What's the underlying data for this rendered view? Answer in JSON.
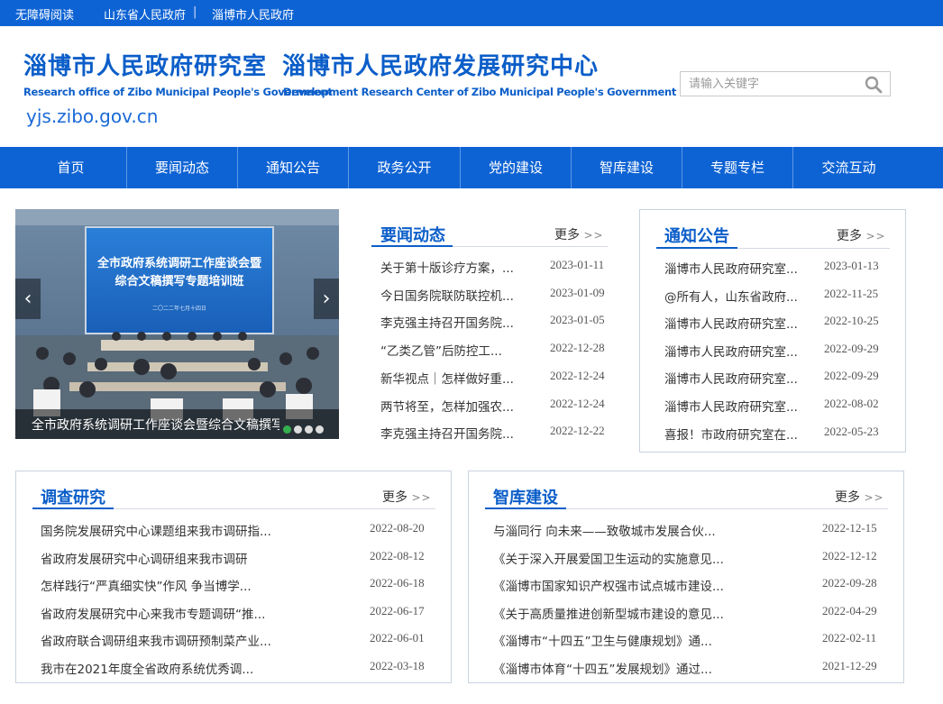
{
  "topbar": {
    "accessibility": "无障碍阅读",
    "link1": "山东省人民政府",
    "separator": "|",
    "link2": "淄博市人民政府"
  },
  "header": {
    "title_cn_1": "淄博市人民政府研究室",
    "title_cn_2": "淄博市人民政府发展研究中心",
    "title_en_1": "Research office of Zibo Municipal People's Government",
    "title_en_2": "Development Research Center of Zibo Municipal People's Government",
    "domain": "yjs.zibo.gov.cn",
    "search_placeholder": "请输入关键字"
  },
  "nav": [
    "首页",
    "要闻动态",
    "通知公告",
    "政务公开",
    "党的建设",
    "智库建设",
    "专题专栏",
    "交流互动"
  ],
  "slider": {
    "caption": "全市政府系统调研工作座谈会暨综合文稿撰写专题培训班",
    "screen_line1": "全市政府系统调研工作座谈会暨",
    "screen_line2": "综合文稿撰写专题培训班",
    "screen_date": "二〇二二年七月十四日",
    "prev": "‹",
    "next": "›"
  },
  "more_label": "更多",
  "more_arrow": ">>",
  "news": {
    "title": "要闻动态",
    "items": [
      {
        "title": "关于第十版诊疗方案，...",
        "date": "2023-01-11"
      },
      {
        "title": "今日国务院联防联控机...",
        "date": "2023-01-09"
      },
      {
        "title": "李克强主持召开国务院...",
        "date": "2023-01-05"
      },
      {
        "title": "“乙类乙管”后防控工...",
        "date": "2022-12-28"
      },
      {
        "title": "新华视点｜怎样做好重...",
        "date": "2022-12-24"
      },
      {
        "title": "两节将至，怎样加强农...",
        "date": "2022-12-24"
      },
      {
        "title": "李克强主持召开国务院...",
        "date": "2022-12-22"
      }
    ]
  },
  "notice": {
    "title": "通知公告",
    "items": [
      {
        "title": "淄博市人民政府研究室...",
        "date": "2023-01-13"
      },
      {
        "title": "@所有人，山东省政府...",
        "date": "2022-11-25"
      },
      {
        "title": "淄博市人民政府研究室...",
        "date": "2022-10-25"
      },
      {
        "title": "淄博市人民政府研究室...",
        "date": "2022-09-29"
      },
      {
        "title": "淄博市人民政府研究室...",
        "date": "2022-09-29"
      },
      {
        "title": "淄博市人民政府研究室...",
        "date": "2022-08-02"
      },
      {
        "title": "喜报！市政府研究室在...",
        "date": "2022-05-23"
      }
    ]
  },
  "research": {
    "title": "调查研究",
    "items": [
      {
        "title": "国务院发展研究中心课题组来我市调研指...",
        "date": "2022-08-20"
      },
      {
        "title": "省政府发展研究中心调研组来我市调研",
        "date": "2022-08-12"
      },
      {
        "title": "怎样践行“严真细实快”作风 争当博学...",
        "date": "2022-06-18"
      },
      {
        "title": "省政府发展研究中心来我市专题调研“推...",
        "date": "2022-06-17"
      },
      {
        "title": "省政府联合调研组来我市调研预制菜产业...",
        "date": "2022-06-01"
      },
      {
        "title": "我市在2021年度全省政府系统优秀调...",
        "date": "2022-03-18"
      }
    ]
  },
  "thinktank": {
    "title": "智库建设",
    "items": [
      {
        "title": "与淄同行 向未来——致敬城市发展合伙...",
        "date": "2022-12-15"
      },
      {
        "title": "《关于深入开展爱国卫生运动的实施意见...",
        "date": "2022-12-12"
      },
      {
        "title": "《淄博市国家知识产权强市试点城市建设...",
        "date": "2022-09-28"
      },
      {
        "title": "《关于高质量推进创新型城市建设的意见...",
        "date": "2022-04-29"
      },
      {
        "title": "《淄博市“十四五”卫生与健康规划》通...",
        "date": "2022-02-11"
      },
      {
        "title": "《淄博市体育“十四五”发展规划》通过...",
        "date": "2021-12-29"
      }
    ]
  },
  "colors": {
    "primary": "#0e63d4",
    "title_blue": "#0b5ec9",
    "active_dot": "#35b050"
  }
}
